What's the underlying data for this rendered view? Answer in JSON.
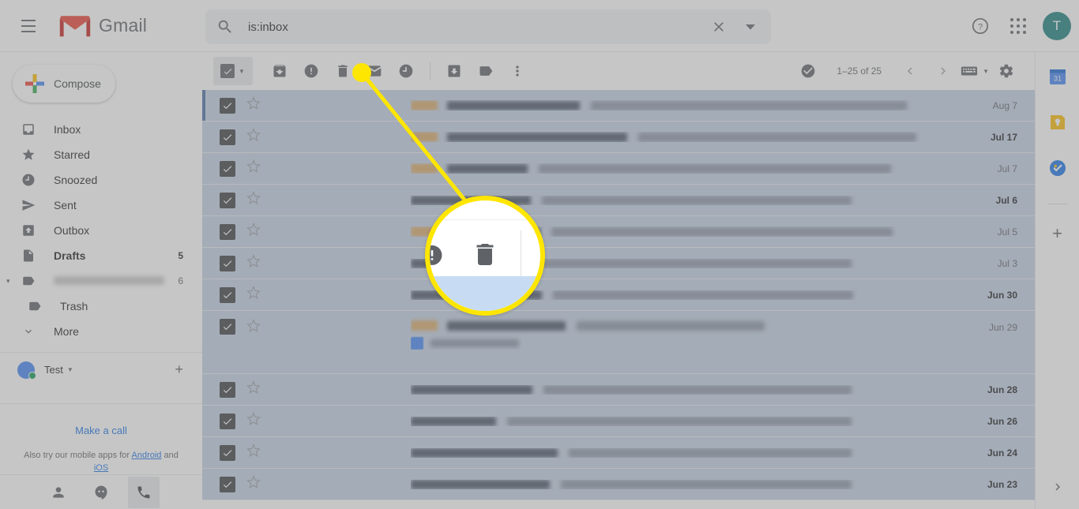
{
  "app": {
    "name": "Gmail",
    "accent_color": "#1a73e8",
    "annotation_color": "#ffe600",
    "avatar_color": "#1a7f7f",
    "avatar_initial": "T"
  },
  "header": {
    "menu_label": "Main menu",
    "logo_label": "Gmail",
    "help_label": "Support",
    "apps_label": "Google apps",
    "account_label": "Google Account: Test"
  },
  "search": {
    "value": "is:inbox",
    "placeholder": "Search mail",
    "clear_label": "Clear search",
    "options_label": "Show search options"
  },
  "sidebar": {
    "compose_label": "Compose",
    "items": [
      {
        "label": "Inbox",
        "icon": "inbox-icon",
        "count": "",
        "bold": false,
        "indent": false,
        "caret": ""
      },
      {
        "label": "Starred",
        "icon": "star-icon",
        "count": "",
        "bold": false,
        "indent": false,
        "caret": ""
      },
      {
        "label": "Snoozed",
        "icon": "clock-icon",
        "count": "",
        "bold": false,
        "indent": false,
        "caret": ""
      },
      {
        "label": "Sent",
        "icon": "send-icon",
        "count": "",
        "bold": false,
        "indent": false,
        "caret": ""
      },
      {
        "label": "Outbox",
        "icon": "outbox-icon",
        "count": "",
        "bold": false,
        "indent": false,
        "caret": ""
      },
      {
        "label": "Drafts",
        "icon": "draft-icon",
        "count": "5",
        "bold": true,
        "indent": false,
        "caret": ""
      },
      {
        "label": "",
        "icon": "label-icon",
        "count": "6",
        "bold": false,
        "indent": false,
        "caret": "▾",
        "redacted": true
      },
      {
        "label": "Trash",
        "icon": "label-icon",
        "count": "",
        "bold": false,
        "indent": true,
        "caret": ""
      },
      {
        "label": "More",
        "icon": "chevron-down-icon",
        "count": "",
        "bold": false,
        "indent": false,
        "caret": ""
      }
    ],
    "account": {
      "name": "Test",
      "add_label": "+"
    },
    "hangouts": {
      "call_link": "Make a call",
      "note_prefix": "Also try our mobile apps for ",
      "android_link": "Android",
      "note_mid": " and ",
      "ios_link": "iOS"
    },
    "bottom_bar": {
      "contacts_label": "Contacts",
      "conversations_label": "Conversations",
      "phone_label": "Phone calls"
    }
  },
  "toolbar": {
    "select_all_label": "Select",
    "select_dropdown_label": "Select options",
    "buttons": [
      {
        "name": "archive-button",
        "label": "Archive"
      },
      {
        "name": "report-spam-button",
        "label": "Report spam"
      },
      {
        "name": "delete-button",
        "label": "Delete"
      },
      {
        "name": "mark-unread-button",
        "label": "Mark as unread"
      },
      {
        "name": "snooze-button",
        "label": "Snooze"
      },
      {
        "name": "move-to-button",
        "label": "Move to"
      },
      {
        "name": "labels-button",
        "label": "Labels"
      },
      {
        "name": "more-button",
        "label": "More"
      }
    ],
    "mark_done_label": "Mark as done",
    "count_text": "1–25 of 25",
    "newer_label": "Newer",
    "older_label": "Older",
    "input_tools_label": "Select input tool",
    "settings_label": "Settings"
  },
  "list": {
    "rows": [
      {
        "date": "Aug 7",
        "unread": false,
        "first": true,
        "tall": false,
        "sender_w": 48,
        "subject_w": 168,
        "snippet_w": 400,
        "chip": true,
        "attachment": false
      },
      {
        "date": "Jul 17",
        "unread": true,
        "first": false,
        "tall": false,
        "sender_w": 62,
        "subject_w": 228,
        "snippet_w": 352,
        "chip": true,
        "attachment": false
      },
      {
        "date": "Jul 7",
        "unread": false,
        "first": false,
        "tall": false,
        "sender_w": 54,
        "subject_w": 102,
        "snippet_w": 446,
        "chip": true,
        "attachment": false
      },
      {
        "date": "Jul 6",
        "unread": true,
        "first": false,
        "tall": false,
        "sender_w": 92,
        "subject_w": 152,
        "snippet_w": 392,
        "chip": false,
        "attachment": false
      },
      {
        "date": "Jul 5",
        "unread": false,
        "first": false,
        "tall": false,
        "sender_w": 60,
        "subject_w": 118,
        "snippet_w": 432,
        "chip": true,
        "attachment": false
      },
      {
        "date": "Jul 3",
        "unread": false,
        "first": false,
        "tall": false,
        "sender_w": 96,
        "subject_w": 140,
        "snippet_w": 404,
        "chip": false,
        "attachment": false
      },
      {
        "date": "Jun 30",
        "unread": true,
        "first": false,
        "tall": false,
        "sender_w": 92,
        "subject_w": 166,
        "snippet_w": 380,
        "chip": false,
        "attachment": false
      },
      {
        "date": "Jun 29",
        "unread": false,
        "first": false,
        "tall": true,
        "sender_w": 78,
        "subject_w": 150,
        "snippet_w": 238,
        "chip": true,
        "attachment": true
      },
      {
        "date": "Jun 28",
        "unread": true,
        "first": false,
        "tall": false,
        "sender_w": 92,
        "subject_w": 154,
        "snippet_w": 390,
        "chip": false,
        "attachment": false
      },
      {
        "date": "Jun 26",
        "unread": true,
        "first": false,
        "tall": false,
        "sender_w": 92,
        "subject_w": 108,
        "snippet_w": 436,
        "chip": false,
        "attachment": false
      },
      {
        "date": "Jun 24",
        "unread": true,
        "first": false,
        "tall": false,
        "sender_w": 92,
        "subject_w": 186,
        "snippet_w": 358,
        "chip": false,
        "attachment": false
      },
      {
        "date": "Jun 23",
        "unread": true,
        "first": false,
        "tall": false,
        "sender_w": 92,
        "subject_w": 176,
        "snippet_w": 368,
        "chip": false,
        "attachment": false
      }
    ]
  },
  "rail": {
    "items": [
      {
        "name": "google-calendar-icon",
        "label": "Calendar",
        "badge": "31"
      },
      {
        "name": "google-keep-icon",
        "label": "Keep",
        "badge": ""
      },
      {
        "name": "google-tasks-icon",
        "label": "Tasks",
        "badge": ""
      }
    ],
    "add_label": "Get add-ons",
    "expand_label": "Show side panel"
  },
  "annotation": {
    "target": "delete-button",
    "magnified_icon": "trash-icon"
  }
}
